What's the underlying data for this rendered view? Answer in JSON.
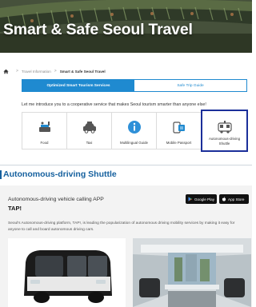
{
  "hero": {
    "title": "Smart & Safe Seoul Travel"
  },
  "breadcrumb": {
    "home_icon": "home-icon",
    "parent": "Travel Information",
    "separator": ">",
    "current": "Smart & Safe Seoul Travel"
  },
  "tabs": [
    {
      "label": "Optimized Smart Tourism Services",
      "active": true
    },
    {
      "label": "Safe Trip Guide",
      "active": false
    }
  ],
  "intro": "Let me introduce you to a cooperative service that makes Seoul tourism smarter than anyone else!",
  "services": [
    {
      "label": "Food",
      "icon": "food-icon"
    },
    {
      "label": "Taxi",
      "icon": "taxi-icon"
    },
    {
      "label": "Multilingual Guide",
      "icon": "info-icon"
    },
    {
      "label": "Mobile Passport",
      "icon": "mobile-passport-icon"
    },
    {
      "label_line1": "Autonomous-driving",
      "label_line2": "Shuttle",
      "icon": "shuttle-icon",
      "selected": true
    }
  ],
  "shuttle": {
    "section_title": "Autonomous-driving Shuttle",
    "app_subtitle": "Autonomous-driving vehicle calling APP",
    "app_name": "TAP!",
    "google_play": "Google Play",
    "app_store": "App Store",
    "description": "Seoul's Autonomous-driving platform, TAP!, is leading the popularization of autonomous driving mobility services by making it easy for anyone to call and board autonomous driving cars."
  },
  "colors": {
    "accent": "#1f8ad0",
    "selected_border": "#1b2f9a",
    "section_title": "#15609e"
  }
}
